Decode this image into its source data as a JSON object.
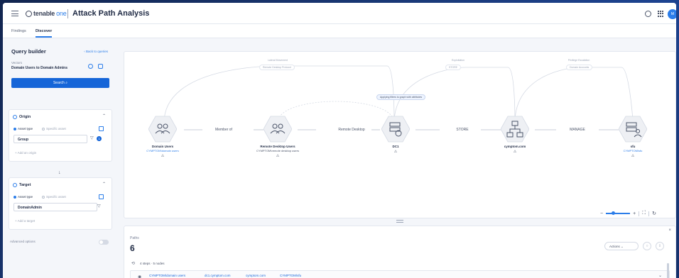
{
  "header": {
    "logo_brand": "tenable",
    "logo_suffix": "one",
    "title": "Attack Path Analysis",
    "avatar_initials": "M"
  },
  "tabs": [
    {
      "label": "Findings",
      "active": false
    },
    {
      "label": "Discover",
      "active": true
    }
  ],
  "query_builder": {
    "title": "Query builder",
    "back_link": "Back to queries",
    "vectors_label": "Vectors",
    "vector_value": "Domain Users to Domain Admins",
    "search_button": "Search"
  },
  "origin": {
    "title": "Origin",
    "asset_type_label": "Asset type",
    "specific_asset_label": "Specific asset",
    "field_value": "Group",
    "filter_count": "1",
    "add_link": "Add an origin"
  },
  "target": {
    "title": "Target",
    "asset_type_label": "Asset type",
    "specific_asset_label": "Specific asset",
    "field_value": "DomainAdmin",
    "add_link": "Add a target"
  },
  "advanced_options": {
    "label": "Advanced options",
    "enabled": false
  },
  "graph": {
    "nodes": [
      {
        "name": "Domain Users",
        "sub": "CYMPTOM\\domain users",
        "icon": "users-icon"
      },
      {
        "name": "Remote Desktop Users",
        "sub": "CYMPTOM\\remote desktop users",
        "icon": "users-icon"
      },
      {
        "name": "DC1",
        "sub": "",
        "icon": "server-gear-icon"
      },
      {
        "name": "cymptom.com",
        "sub": "",
        "icon": "hierarchy-icon"
      },
      {
        "name": "sfu",
        "sub": "CYMPTOM\\sfu",
        "icon": "user-server-icon"
      }
    ],
    "edges": [
      {
        "label": "Member of"
      },
      {
        "label": "Remote Desktop"
      },
      {
        "label": "STORE"
      },
      {
        "label": "MANAGE"
      }
    ],
    "arc_tags": [
      {
        "label": "Lateral Movement",
        "pill": "Remote Desktop Protocol"
      },
      {
        "label": "Exploitation",
        "pill": "STORE"
      },
      {
        "label": "Privilege Escalation",
        "pill": "Domain Accounts"
      }
    ],
    "mid_pill": "Applying filters to graph with attributes",
    "zoom_minus": "−",
    "zoom_plus": "+"
  },
  "paths": {
    "title": "Paths",
    "count": "6",
    "actions_label": "Actions",
    "steps_text": "4 steps · 5 nodes",
    "row_chips": [
      "CYMPTOM\\domain users",
      "dc1.cymptom.com",
      "cymptom.com",
      "CYMPTOM\\sfu"
    ]
  }
}
